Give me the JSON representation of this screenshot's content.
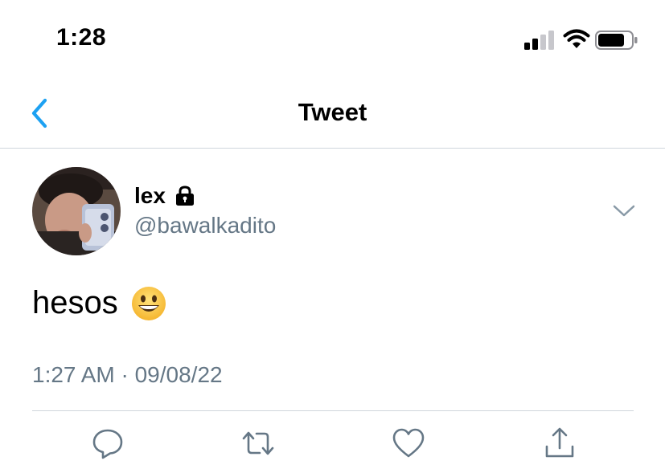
{
  "status_bar": {
    "time": "1:28",
    "icons": [
      "cellular-signal-icon",
      "wifi-icon",
      "battery-icon"
    ]
  },
  "nav": {
    "title": "Tweet",
    "back_icon": "chevron-left-icon"
  },
  "tweet": {
    "display_name": "lex",
    "protected_icon": "lock-icon",
    "handle": "@bawalkadito",
    "text": "hesos",
    "emoji": "grinning-face-emoji",
    "timestamp": "1:27 AM · 09/08/22",
    "more_icon": "chevron-down-icon"
  },
  "actions": [
    "reply-icon",
    "retweet-icon",
    "like-icon",
    "share-icon"
  ],
  "colors": {
    "accent": "#1da1f2",
    "secondary_text": "#657786",
    "divider": "#cfd6dc",
    "icon_gray": "#657786"
  }
}
